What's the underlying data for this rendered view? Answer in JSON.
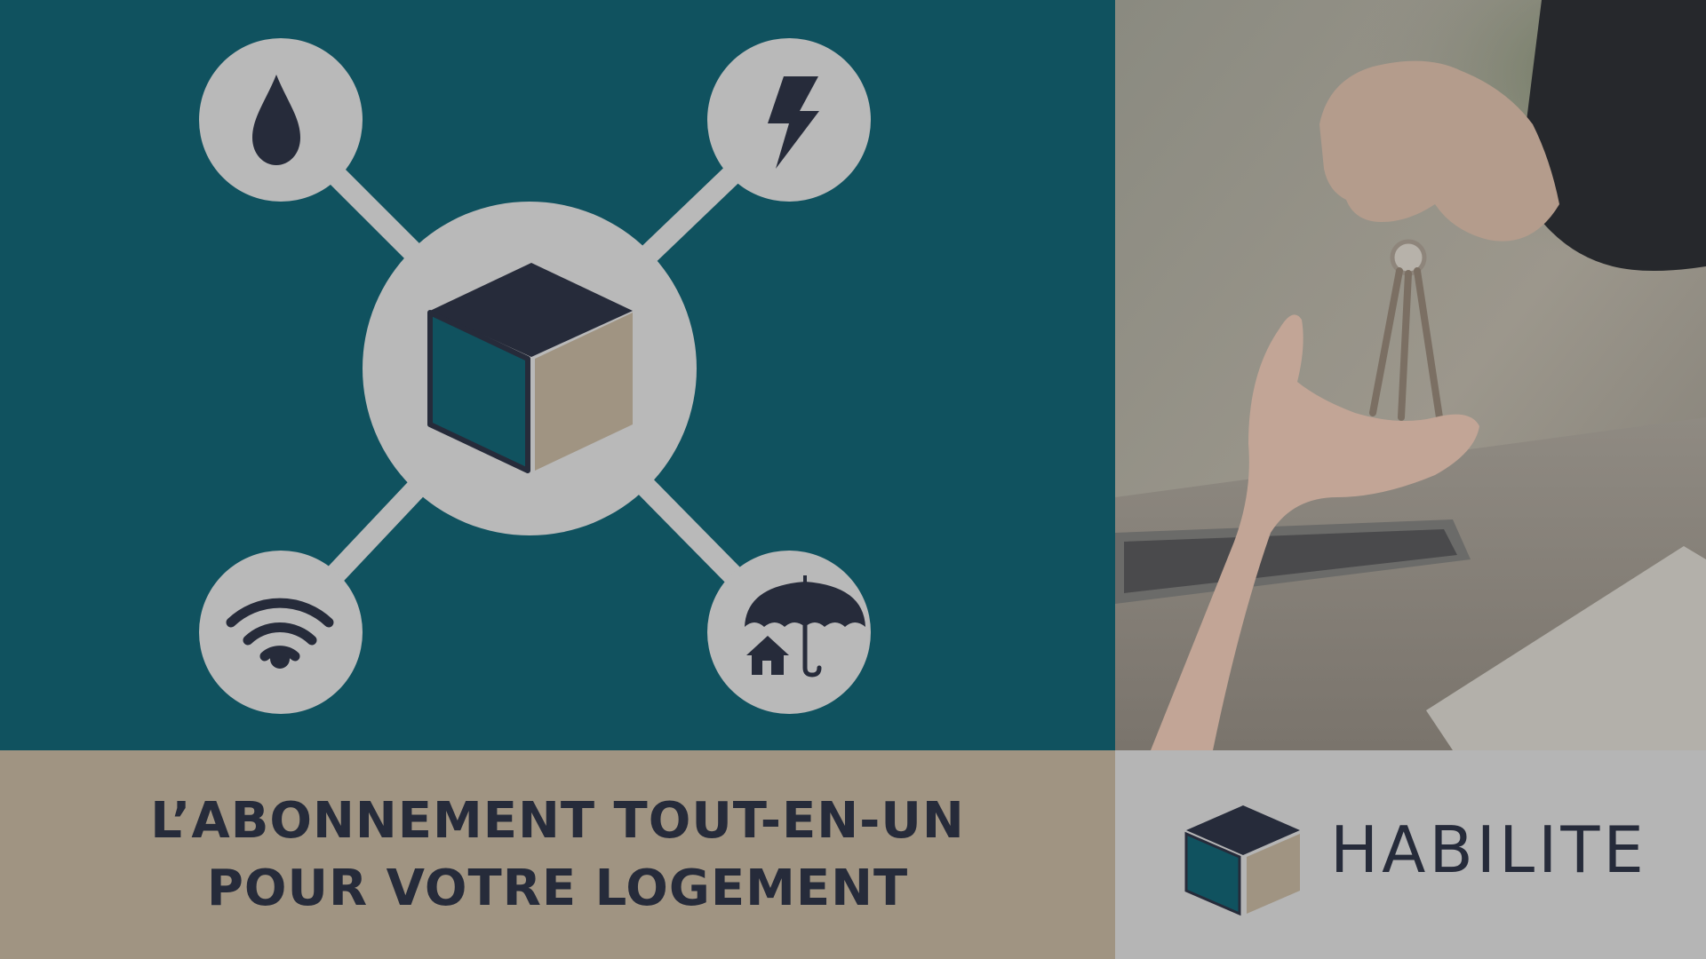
{
  "tagline": {
    "line1": "L’ABONNEMENT TOUT-EN-UN",
    "line2": "POUR VOTRE LOGEMENT"
  },
  "brand": {
    "name": "HABILITE"
  },
  "colors": {
    "teal": "#10525f",
    "taupe": "#a09482",
    "light_gray": "#b5b5b5",
    "navy": "#262b3a"
  },
  "icons": [
    "water-drop-icon",
    "lightning-icon",
    "wifi-icon",
    "home-insurance-icon",
    "cube-icon"
  ],
  "photo": {
    "subject": "hand-handing-keys"
  }
}
